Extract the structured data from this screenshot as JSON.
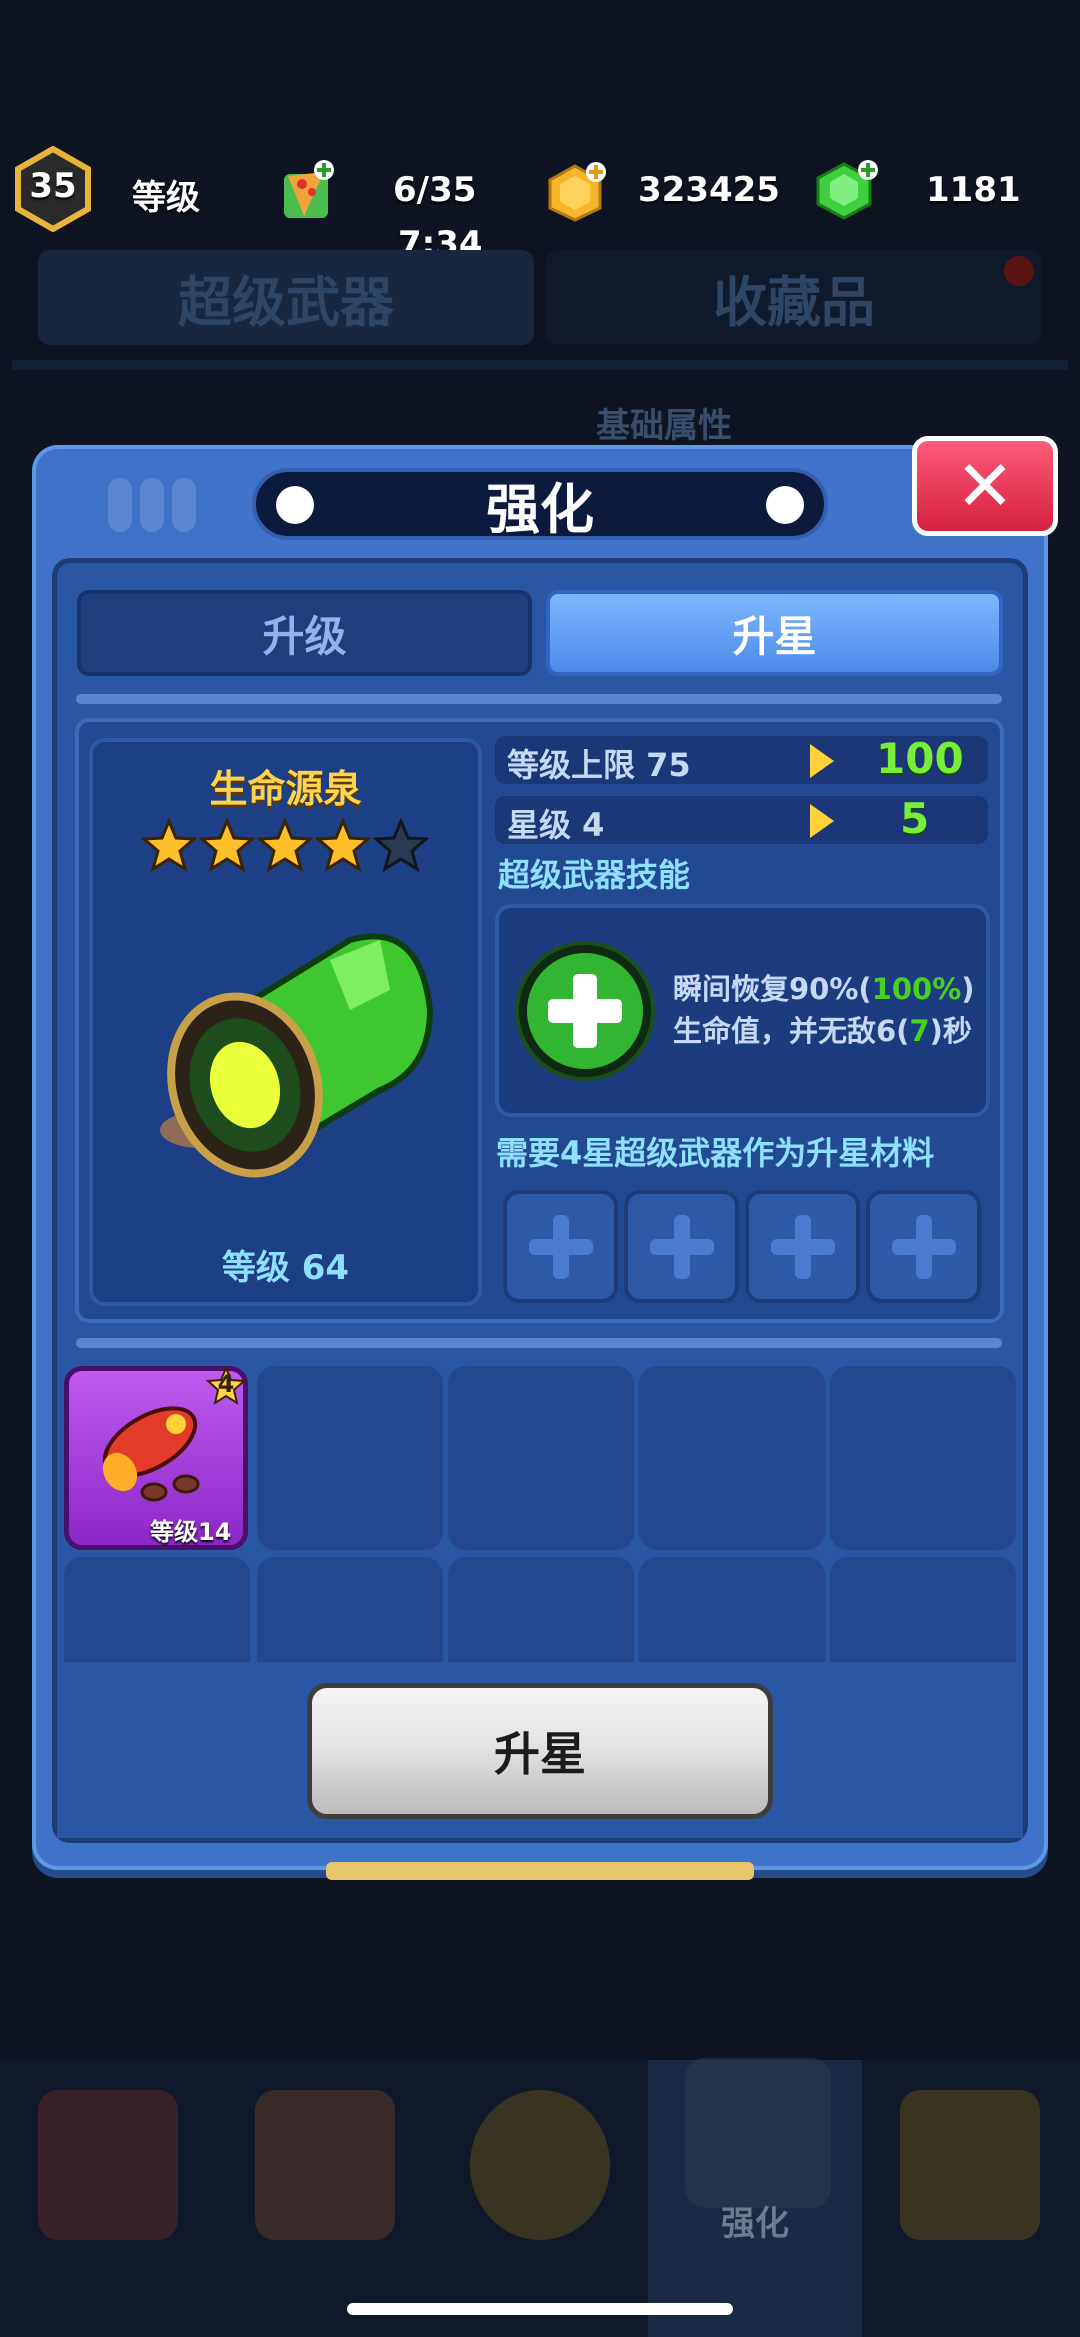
{
  "header": {
    "player_level": "35",
    "level_label": "等级",
    "energy": "6/35",
    "energy_timer": "7:34",
    "coins": "323425",
    "gems": "1181"
  },
  "background": {
    "tabs": [
      "超级武器",
      "收藏品"
    ],
    "section_label": "基础属性",
    "nav_active_label": "强化"
  },
  "dialog": {
    "title": "强化",
    "close_symbol": "✕",
    "tabs": [
      {
        "label": "升级",
        "active": false
      },
      {
        "label": "升星",
        "active": true
      }
    ],
    "weapon": {
      "name": "生命源泉",
      "stars": 4,
      "max_stars": 5,
      "level_text": "等级 64"
    },
    "stats": [
      {
        "label": "等级上限 75",
        "new_value": "100"
      },
      {
        "label": "星级 4",
        "new_value": "5"
      }
    ],
    "skill": {
      "title": "超级武器技能",
      "desc_parts": [
        "瞬间恢复90%(",
        "100%",
        ")生命值，并无敌6(",
        "7",
        ")秒"
      ]
    },
    "requirement": "需要4星超级武器作为升星材料",
    "material_slots": 4,
    "inventory": [
      {
        "level_text": "等级14",
        "stars": "4"
      }
    ],
    "action_button": "升星"
  },
  "colors": {
    "accent_green": "#78ee3a",
    "gold": "#ffd34a",
    "dialog_blue": "#3f73c9"
  }
}
